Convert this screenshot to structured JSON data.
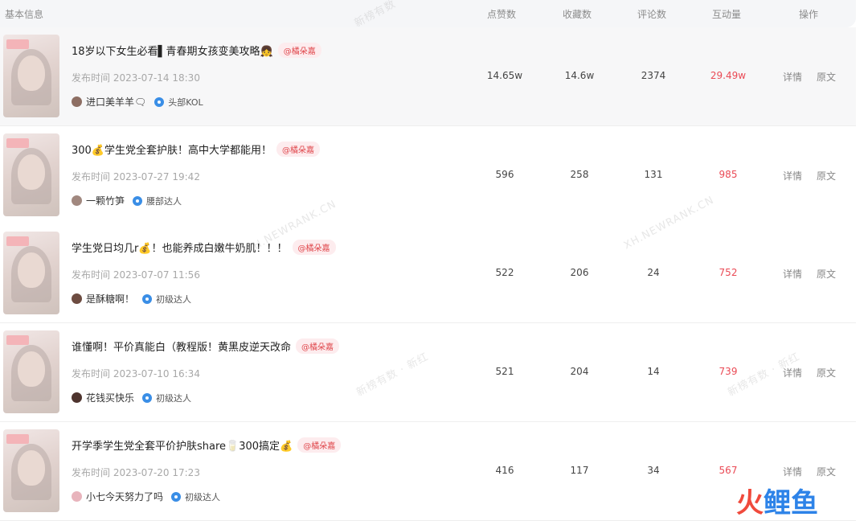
{
  "header": {
    "basic": "基本信息",
    "likes": "点赞数",
    "favs": "收藏数",
    "comments": "评论数",
    "interactions": "互动量",
    "ops": "操作"
  },
  "rows": [
    {
      "title": "18岁以下女生必看▌青春期女孩变美攻略👧",
      "badge": "@橘朵嘉",
      "time": "发布时间 2023-07-14 18:30",
      "author": "进口美羊羊🗨",
      "level": "头部KOL",
      "likes": "14.65w",
      "favs": "14.6w",
      "comments": "2374",
      "interactions": "29.49w",
      "detail": "详情",
      "original": "原文"
    },
    {
      "title": "300💰学生党全套护肤！高中大学都能用！",
      "badge": "@橘朵嘉",
      "time": "发布时间 2023-07-27 19:42",
      "author": "一颗竹笋",
      "level": "腰部达人",
      "likes": "596",
      "favs": "258",
      "comments": "131",
      "interactions": "985",
      "detail": "详情",
      "original": "原文"
    },
    {
      "title": "学生党日均几r💰！也能养成白嫩牛奶肌！！！",
      "badge": "@橘朵嘉",
      "time": "发布时间 2023-07-07 11:56",
      "author": "是酥糖啊！",
      "level": "初级达人",
      "likes": "522",
      "favs": "206",
      "comments": "24",
      "interactions": "752",
      "detail": "详情",
      "original": "原文"
    },
    {
      "title": "谁懂啊！平价真能白（教程版！黄黑皮逆天改命",
      "badge": "@橘朵嘉",
      "time": "发布时间 2023-07-10 16:34",
      "author": "花钱买快乐",
      "level": "初级达人",
      "likes": "521",
      "favs": "204",
      "comments": "14",
      "interactions": "739",
      "detail": "详情",
      "original": "原文"
    },
    {
      "title": "开学季学生党全套平价护肤share🥛300搞定💰",
      "badge": "@橘朵嘉",
      "time": "发布时间 2023-07-20 17:23",
      "author": "小七今天努力了吗",
      "level": "初级达人",
      "likes": "416",
      "favs": "117",
      "comments": "34",
      "interactions": "567",
      "detail": "详情",
      "original": "原文"
    }
  ],
  "watermarks": [
    "新榜有数",
    "XH.NEWRANK.CN",
    "XH.NEWRANK.CN",
    "新榜有数 · 新红",
    "新榜有数 · 新红"
  ],
  "logo": {
    "part1": "火",
    "part2": "鲤鱼"
  },
  "colors": {
    "interaction": "#ea4a55",
    "badge": "#e0474c",
    "level_icon": "#3a8ee6",
    "header_bg": "#f5f6f8"
  }
}
